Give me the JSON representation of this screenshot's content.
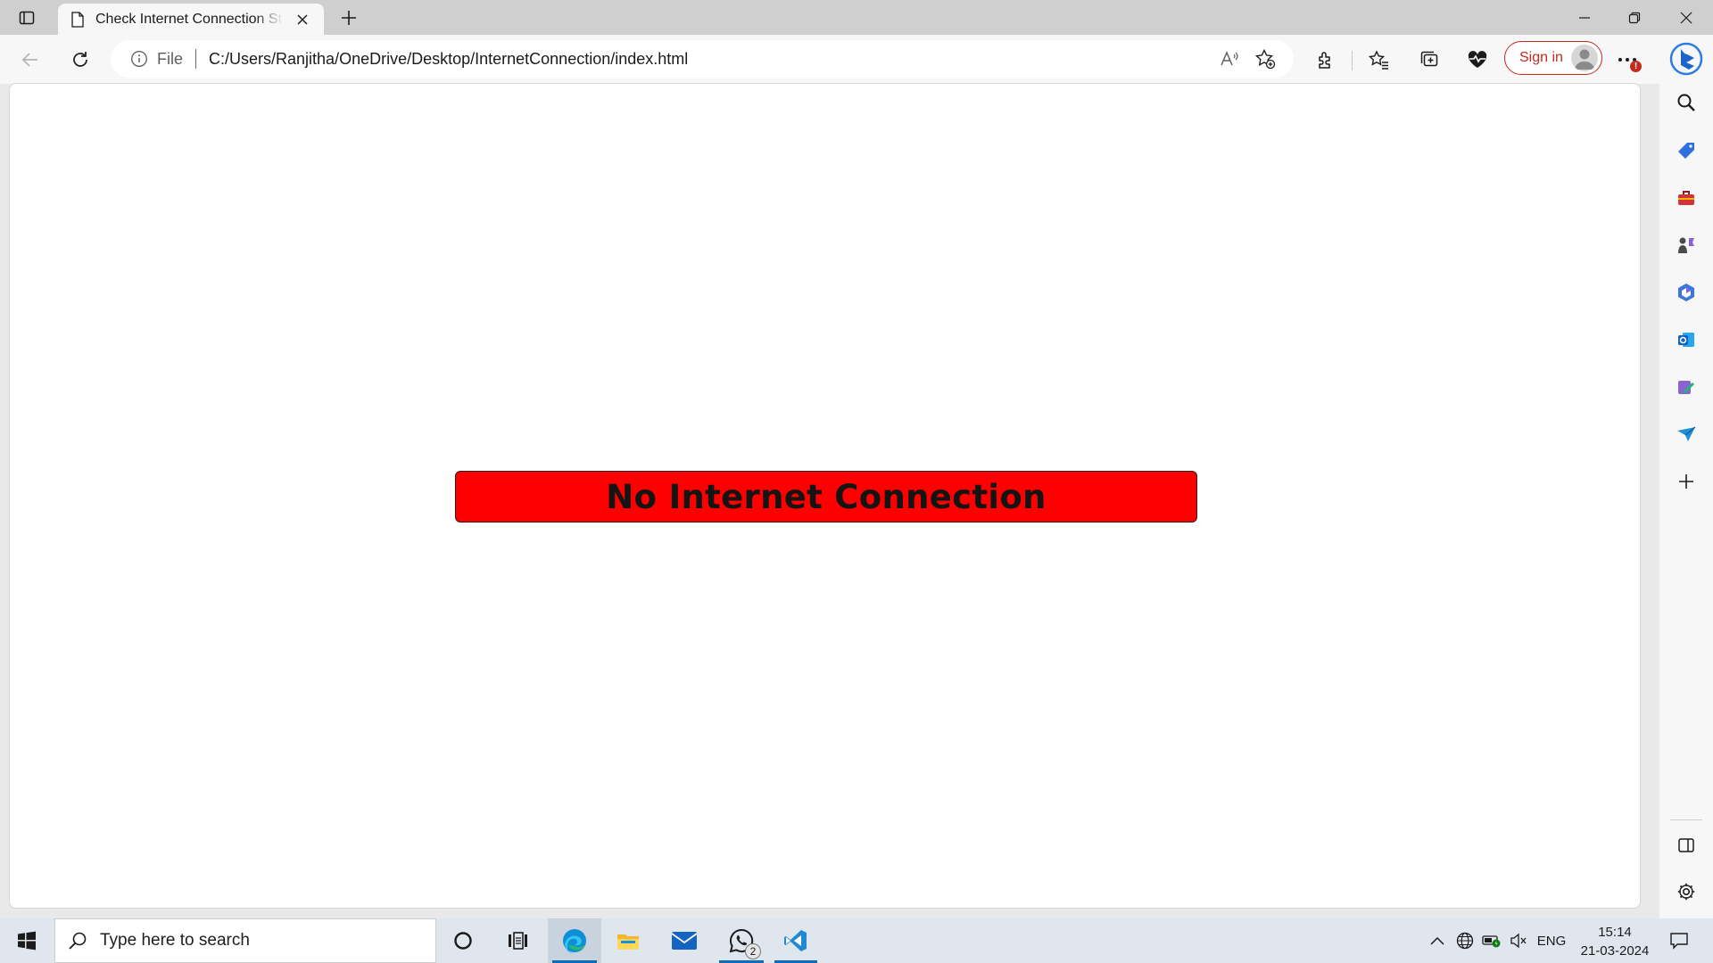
{
  "browser": {
    "tab_title": "Check Internet Connection Status",
    "address": {
      "scheme_label": "File",
      "url": "C:/Users/Ranjitha/OneDrive/Desktop/InternetConnection/index.html"
    },
    "signin_label": "Sign in",
    "more_badge": "!"
  },
  "page": {
    "status_message": "No Internet Connection",
    "banner_color": "#ff0000"
  },
  "sidebar": {
    "items": [
      "search-icon",
      "shopping-tag-icon",
      "tools-icon",
      "games-icon",
      "microsoft365-icon",
      "outlook-icon",
      "designer-icon",
      "drop-icon",
      "add-icon"
    ],
    "bottom": [
      "split-screen-icon",
      "settings-icon"
    ]
  },
  "taskbar": {
    "search_placeholder": "Type here to search",
    "apps": [
      "cortana-icon",
      "task-view-icon",
      "edge-icon",
      "file-explorer-icon",
      "mail-icon",
      "whatsapp-icon",
      "vscode-icon"
    ],
    "whatsapp_badge": "2",
    "language": "ENG",
    "time": "15:14",
    "date": "21-03-2024"
  }
}
